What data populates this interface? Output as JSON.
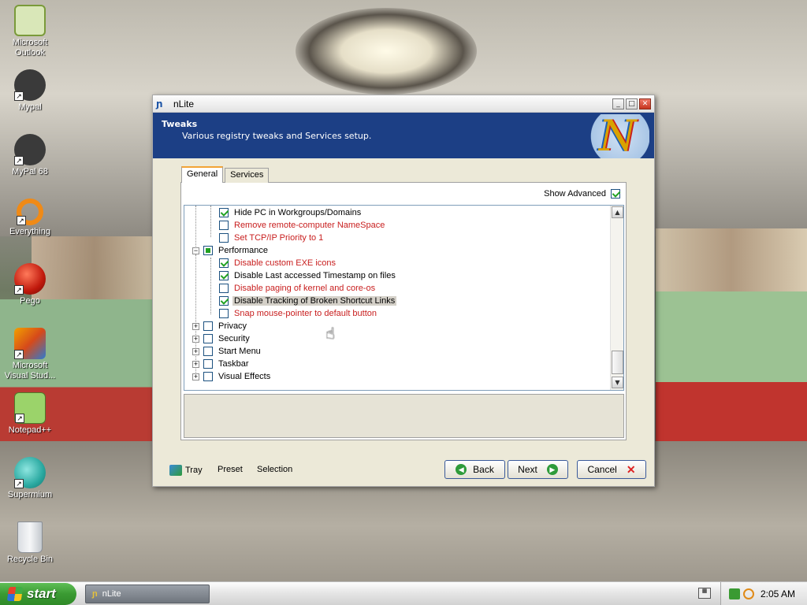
{
  "desktop": {
    "icons": [
      {
        "label": "Microsoft\nOutlook",
        "icon": "outlook-icon"
      },
      {
        "label": "Mypal",
        "icon": "mypal-icon"
      },
      {
        "label": "MyPal 68",
        "icon": "mypal68-icon"
      },
      {
        "label": "Everything",
        "icon": "everything-icon"
      },
      {
        "label": "Pego",
        "icon": "pego-icon"
      },
      {
        "label": "Microsoft\nVisual Stud...",
        "icon": "visual-studio-icon"
      },
      {
        "label": "Notepad++",
        "icon": "notepadpp-icon"
      },
      {
        "label": "Supermium",
        "icon": "supermium-icon"
      },
      {
        "label": "Recycle Bin",
        "icon": "recycle-bin-icon"
      }
    ]
  },
  "window": {
    "title": "nLite",
    "header_title": "Tweaks",
    "header_subtitle": "Various registry tweaks and Services setup.",
    "tabs": [
      "General",
      "Services"
    ],
    "active_tab": "General",
    "show_advanced_label": "Show Advanced",
    "show_advanced_checked": true,
    "tree": [
      {
        "label": "Hide PC in Workgroups/Domains",
        "checked": true,
        "red": false
      },
      {
        "label": "Remove remote-computer NameSpace",
        "checked": false,
        "red": true
      },
      {
        "label": "Set TCP/IP Priority to 1",
        "checked": false,
        "red": true
      },
      {
        "label": "Performance",
        "state": "partial",
        "group": true
      },
      {
        "label": "Disable custom EXE icons",
        "checked": true,
        "red": true
      },
      {
        "label": "Disable Last accessed Timestamp on files",
        "checked": true,
        "red": false
      },
      {
        "label": "Disable paging of kernel and core-os",
        "checked": false,
        "red": true
      },
      {
        "label": "Disable Tracking of Broken Shortcut Links",
        "checked": true,
        "red": false,
        "selected": true
      },
      {
        "label": "Snap mouse-pointer to default button",
        "checked": false,
        "red": true
      },
      {
        "label": "Privacy",
        "group": true
      },
      {
        "label": "Security",
        "group": true
      },
      {
        "label": "Start Menu",
        "group": true
      },
      {
        "label": "Taskbar",
        "group": true
      },
      {
        "label": "Visual Effects",
        "group": true
      }
    ],
    "bottom": {
      "tray_label": "Tray",
      "preset_label": "Preset",
      "selection_label": "Selection",
      "back_label": "Back",
      "next_label": "Next",
      "cancel_label": "Cancel"
    }
  },
  "taskbar": {
    "start_label": "start",
    "task_label": "nLite",
    "clock": "2:05 AM"
  },
  "colors": {
    "header_blue": "#1c3f85",
    "unsafe_red": "#c81e1e",
    "check_green": "#21a121"
  }
}
